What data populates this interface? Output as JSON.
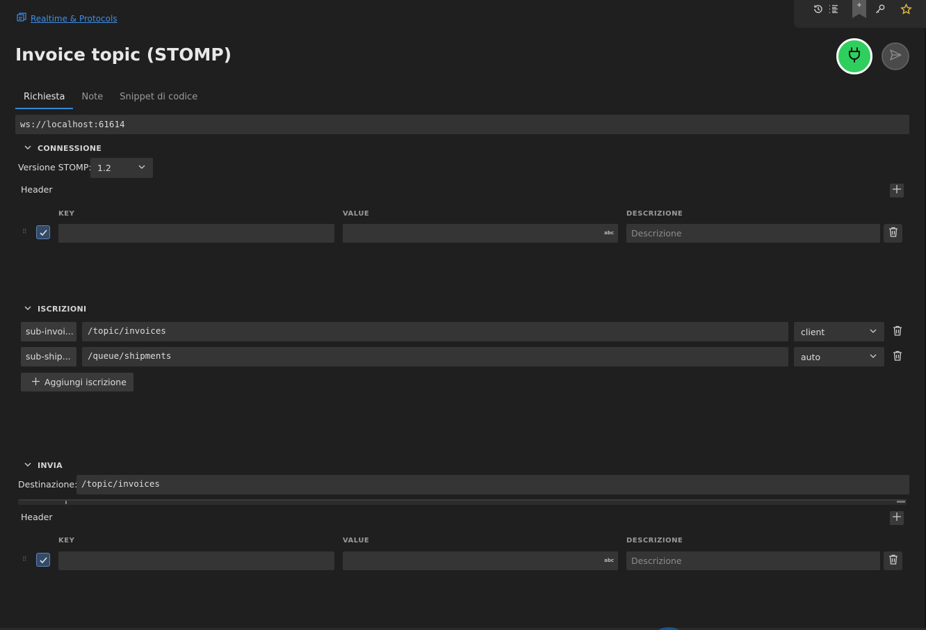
{
  "breadcrumb": {
    "icon": "collection-icon",
    "label": "Realtime & Protocols"
  },
  "title": "Invoice topic (STOMP)",
  "toolbar": {
    "icons": [
      "history-icon",
      "list-icon",
      "bookmark-icon",
      "key-icon",
      "star-icon"
    ],
    "accent": "#e2b93b"
  },
  "actions": {
    "connect_color": "#2fcf5d",
    "connect_icon": "plug-icon",
    "send_icon": "send-icon"
  },
  "tabs": [
    {
      "label": "Richiesta",
      "active": true
    },
    {
      "label": "Note",
      "active": false
    },
    {
      "label": "Snippet di codice",
      "active": false
    }
  ],
  "url": "ws://localhost:61614",
  "connection": {
    "section_label": "CONNESSIONE",
    "version_label": "Versione STOMP:",
    "version_value": "1.2",
    "header_label": "Header",
    "columns": {
      "key": "KEY",
      "value": "VALUE",
      "description": "DESCRIZIONE"
    },
    "row": {
      "checked": true,
      "key": "",
      "value": "",
      "value_badge": "abc",
      "description_placeholder": "Descrizione"
    }
  },
  "subscriptions": {
    "section_label": "ISCRIZIONI",
    "rows": [
      {
        "name": "sub-invoi...",
        "destination": "/topic/invoices",
        "ack": "client"
      },
      {
        "name": "sub-ship...",
        "destination": "/queue/shipments",
        "ack": "auto"
      }
    ],
    "add_label": "Aggiungi iscrizione"
  },
  "send": {
    "section_label": "INVIA",
    "destination_label": "Destinazione:",
    "destination_value": "/topic/invoices",
    "header_label": "Header",
    "columns": {
      "key": "KEY",
      "value": "VALUE",
      "description": "DESCRIZIONE"
    },
    "row": {
      "checked": true,
      "key": "",
      "value": "",
      "value_badge": "abc",
      "description_placeholder": "Descrizione"
    }
  }
}
